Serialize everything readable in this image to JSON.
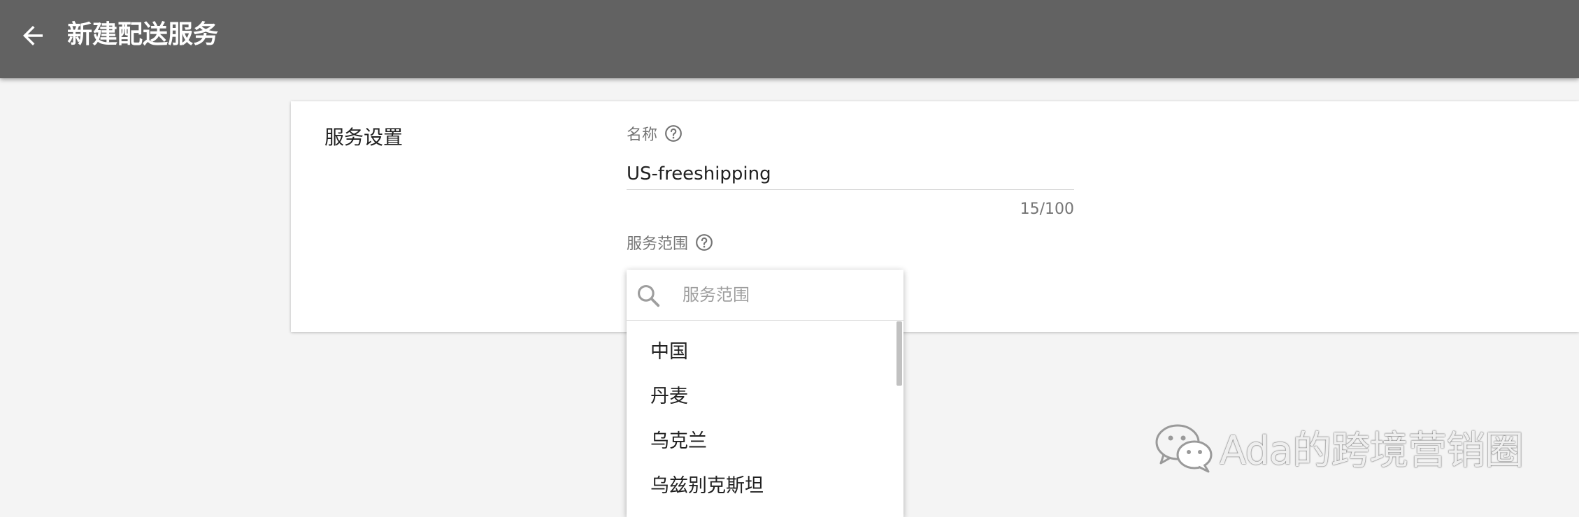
{
  "header": {
    "title": "新建配送服务",
    "back_icon": "arrow-left-icon"
  },
  "service_settings": {
    "section_title": "服务设置",
    "name": {
      "label": "名称",
      "value": "US-freeshipping",
      "counter": "15/100",
      "help_icon": "help-circle-icon"
    },
    "scope": {
      "label": "服务范围",
      "help_icon": "help-circle-icon",
      "dropdown": {
        "search_placeholder": "服务范围",
        "search_icon": "search-icon",
        "options": [
          "中国",
          "丹麦",
          "乌克兰",
          "乌兹别克斯坦"
        ]
      }
    }
  },
  "watermark": {
    "text": "Ada的跨境营销圈",
    "icon": "wechat-icon"
  },
  "colors": {
    "topbar": "#626262",
    "background": "#f4f4f4",
    "card": "#ffffff"
  }
}
